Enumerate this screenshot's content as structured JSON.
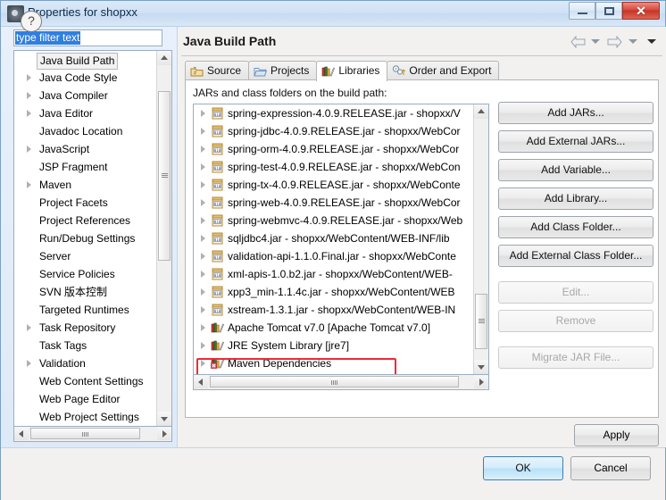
{
  "window": {
    "title": "Properties for shopxx",
    "icon": "properties-icon",
    "controls": {
      "minimize": "minimize-icon",
      "maximize": "maximize-icon",
      "close": "✕"
    }
  },
  "filter": {
    "value": "type filter text",
    "placeholder": "type filter text"
  },
  "sidebar": {
    "items": [
      {
        "label": "Java Build Path",
        "expandable": false,
        "selected": true
      },
      {
        "label": "Java Code Style",
        "expandable": true,
        "selected": false
      },
      {
        "label": "Java Compiler",
        "expandable": true,
        "selected": false
      },
      {
        "label": "Java Editor",
        "expandable": true,
        "selected": false
      },
      {
        "label": "Javadoc Location",
        "expandable": false,
        "selected": false
      },
      {
        "label": "JavaScript",
        "expandable": true,
        "selected": false
      },
      {
        "label": "JSP Fragment",
        "expandable": false,
        "selected": false
      },
      {
        "label": "Maven",
        "expandable": true,
        "selected": false
      },
      {
        "label": "Project Facets",
        "expandable": false,
        "selected": false
      },
      {
        "label": "Project References",
        "expandable": false,
        "selected": false
      },
      {
        "label": "Run/Debug Settings",
        "expandable": false,
        "selected": false
      },
      {
        "label": "Server",
        "expandable": false,
        "selected": false
      },
      {
        "label": "Service Policies",
        "expandable": false,
        "selected": false
      },
      {
        "label": "SVN 版本控制",
        "expandable": false,
        "selected": false
      },
      {
        "label": "Targeted Runtimes",
        "expandable": false,
        "selected": false
      },
      {
        "label": "Task Repository",
        "expandable": true,
        "selected": false
      },
      {
        "label": "Task Tags",
        "expandable": false,
        "selected": false
      },
      {
        "label": "Validation",
        "expandable": true,
        "selected": false
      },
      {
        "label": "Web Content Settings",
        "expandable": false,
        "selected": false
      },
      {
        "label": "Web Page Editor",
        "expandable": false,
        "selected": false
      },
      {
        "label": "Web Project Settings",
        "expandable": false,
        "selected": false
      }
    ]
  },
  "page": {
    "title": "Java Build Path",
    "nav": {
      "back": "back-arrow-icon",
      "forward": "forward-arrow-icon",
      "menu": "dropdown-caret-icon"
    }
  },
  "tabs": [
    {
      "label": "Source",
      "icon": "source-folder-icon",
      "active": false
    },
    {
      "label": "Projects",
      "icon": "projects-folder-icon",
      "active": false
    },
    {
      "label": "Libraries",
      "icon": "libraries-books-icon",
      "active": true
    },
    {
      "label": "Order and Export",
      "icon": "order-export-icon",
      "active": false
    }
  ],
  "libraries": {
    "section_label": "JARs and class folders on the build path:",
    "entries": [
      {
        "label": "spring-expression-4.0.9.RELEASE.jar - shopxx/V",
        "icon": "jar-icon",
        "type": "jar",
        "highlighted": false
      },
      {
        "label": "spring-jdbc-4.0.9.RELEASE.jar - shopxx/WebCor",
        "icon": "jar-icon",
        "type": "jar",
        "highlighted": false
      },
      {
        "label": "spring-orm-4.0.9.RELEASE.jar - shopxx/WebCor",
        "icon": "jar-icon",
        "type": "jar",
        "highlighted": false
      },
      {
        "label": "spring-test-4.0.9.RELEASE.jar - shopxx/WebCon",
        "icon": "jar-icon",
        "type": "jar",
        "highlighted": false
      },
      {
        "label": "spring-tx-4.0.9.RELEASE.jar - shopxx/WebConte",
        "icon": "jar-icon",
        "type": "jar",
        "highlighted": false
      },
      {
        "label": "spring-web-4.0.9.RELEASE.jar - shopxx/WebCor",
        "icon": "jar-icon",
        "type": "jar",
        "highlighted": false
      },
      {
        "label": "spring-webmvc-4.0.9.RELEASE.jar - shopxx/Web",
        "icon": "jar-icon",
        "type": "jar",
        "highlighted": false
      },
      {
        "label": "sqljdbc4.jar - shopxx/WebContent/WEB-INF/lib",
        "icon": "jar-icon",
        "type": "jar",
        "highlighted": false
      },
      {
        "label": "validation-api-1.1.0.Final.jar - shopxx/WebConte",
        "icon": "jar-icon",
        "type": "jar",
        "highlighted": false
      },
      {
        "label": "xml-apis-1.0.b2.jar - shopxx/WebContent/WEB-",
        "icon": "jar-icon",
        "type": "jar",
        "highlighted": false
      },
      {
        "label": "xpp3_min-1.1.4c.jar - shopxx/WebContent/WEB",
        "icon": "jar-icon",
        "type": "jar",
        "highlighted": false
      },
      {
        "label": "xstream-1.3.1.jar - shopxx/WebContent/WEB-IN",
        "icon": "jar-icon",
        "type": "jar",
        "highlighted": false
      },
      {
        "label": "Apache Tomcat v7.0 [Apache Tomcat v7.0]",
        "icon": "library-icon",
        "type": "library",
        "highlighted": false
      },
      {
        "label": "JRE System Library [jre7]",
        "icon": "library-icon",
        "type": "library",
        "highlighted": false
      },
      {
        "label": "Maven Dependencies",
        "icon": "maven-library-icon",
        "type": "library",
        "highlighted": true
      }
    ]
  },
  "side_buttons": [
    {
      "label": "Add JARs...",
      "enabled": true
    },
    {
      "label": "Add External JARs...",
      "enabled": true
    },
    {
      "label": "Add Variable...",
      "enabled": true
    },
    {
      "label": "Add Library...",
      "enabled": true
    },
    {
      "label": "Add Class Folder...",
      "enabled": true
    },
    {
      "label": "Add External Class Folder...",
      "enabled": true
    },
    {
      "label": "Edit...",
      "enabled": false
    },
    {
      "label": "Remove",
      "enabled": false
    },
    {
      "label": "Migrate JAR File...",
      "enabled": false
    }
  ],
  "footer": {
    "apply_label": "Apply",
    "ok_label": "OK",
    "cancel_label": "Cancel",
    "help_icon": "?"
  },
  "colors": {
    "highlight_red": "#ee2b37",
    "selection_blue": "#2f7fe0",
    "title_bar": "#cfe1f4",
    "default_button_blue": "#b7e0f7"
  }
}
